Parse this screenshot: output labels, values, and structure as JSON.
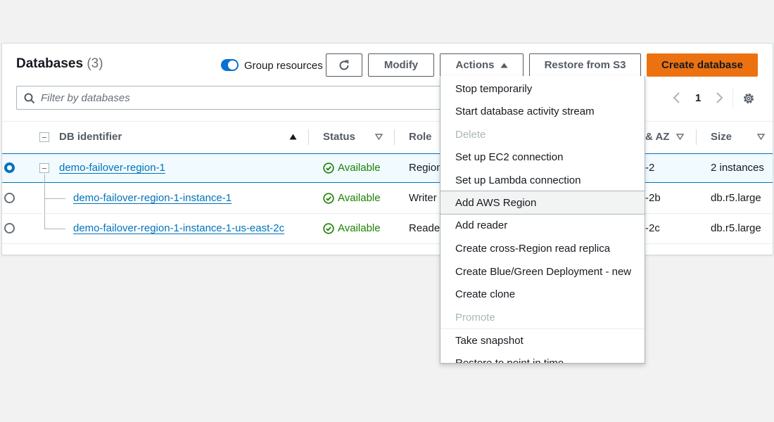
{
  "header": {
    "title": "Databases",
    "count": "(3)",
    "group_resources_label": "Group resources",
    "group_resources_on": true
  },
  "toolbar": {
    "modify_label": "Modify",
    "actions_label": "Actions",
    "restore_label": "Restore from S3",
    "create_label": "Create database"
  },
  "filter": {
    "placeholder": "Filter by databases",
    "value": ""
  },
  "pagination": {
    "page": "1"
  },
  "columns": {
    "db_identifier": "DB identifier",
    "status": "Status",
    "role": "Role",
    "az": "& AZ",
    "size": "Size"
  },
  "rows": [
    {
      "id": "demo-failover-region-1",
      "status": "Available",
      "role": "Region",
      "az": "-2",
      "size": "2 instances",
      "selected": true
    },
    {
      "id": "demo-failover-region-1-instance-1",
      "status": "Available",
      "role": "Writer",
      "az": "-2b",
      "size": "db.r5.large",
      "selected": false
    },
    {
      "id": "demo-failover-region-1-instance-1-us-east-2c",
      "status": "Available",
      "role": "Reader",
      "az": "-2c",
      "size": "db.r5.large",
      "selected": false
    }
  ],
  "actions_menu": [
    {
      "label": "Stop temporarily",
      "disabled": false
    },
    {
      "label": "Start database activity stream",
      "disabled": false
    },
    {
      "label": "Delete",
      "disabled": true
    },
    {
      "label": "Set up EC2 connection",
      "disabled": false
    },
    {
      "label": "Set up Lambda connection",
      "disabled": false
    },
    {
      "label": "Add AWS Region",
      "disabled": false,
      "hovered": true
    },
    {
      "label": "Add reader",
      "disabled": false
    },
    {
      "label": "Create cross-Region read replica",
      "disabled": false
    },
    {
      "label": "Create Blue/Green Deployment - new",
      "disabled": false
    },
    {
      "label": "Create clone",
      "disabled": false
    },
    {
      "label": "Promote",
      "disabled": true
    },
    {
      "label": "Take snapshot",
      "disabled": false
    },
    {
      "label": "Restore to point in time",
      "disabled": false
    }
  ],
  "colors": {
    "accent": "#0073bb",
    "primary_button": "#ec7211",
    "available": "#1d8102"
  }
}
